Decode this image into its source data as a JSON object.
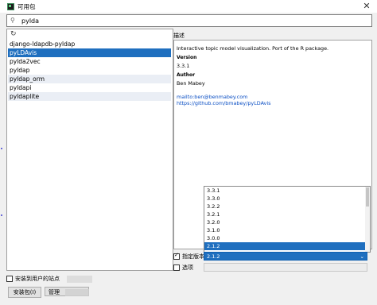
{
  "window": {
    "title": "可用包"
  },
  "search": {
    "value": "pylda"
  },
  "packages": [
    "django-ldapdb-pyldap",
    "pyLDAvis",
    "pylda2vec",
    "pyldap",
    "pyldap_orm",
    "pyldapi",
    "pyldaplite"
  ],
  "selected_package_index": 1,
  "description": {
    "label": "描述",
    "summary": "Interactive topic model visualization. Port of the R package.",
    "version_heading": "Version",
    "version": "3.3.1",
    "author_heading": "Author",
    "author": "Ben Mabey",
    "email": "mailto:ben@benmabey.com",
    "url": "https://github.com/bmabey/pyLDAvis"
  },
  "versions": [
    "3.3.1",
    "3.3.0",
    "3.2.2",
    "3.2.1",
    "3.2.0",
    "3.1.0",
    "3.0.0",
    "2.1.2"
  ],
  "specify_version": {
    "label": "指定版本",
    "checked": true,
    "value": "2.1.2"
  },
  "options": {
    "label": "选项",
    "checked": false
  },
  "user_site": {
    "label": "安装到用户的站点",
    "checked": false
  },
  "buttons": {
    "install": "安装包(I)",
    "manage": "管理"
  },
  "colors": {
    "selection": "#1f6fbf",
    "link": "#0b4fc4"
  },
  "icons": {
    "search": "search-icon",
    "refresh": "refresh-icon",
    "close": "close-icon"
  }
}
